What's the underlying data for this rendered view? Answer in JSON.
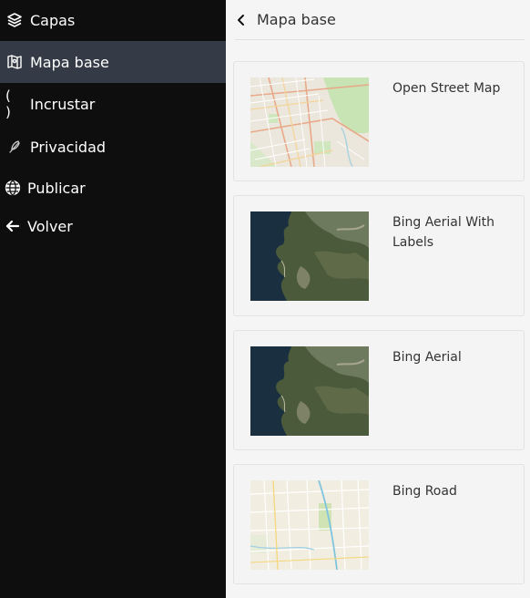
{
  "sidebar": {
    "items": [
      {
        "label": "Capas",
        "icon": "layers-icon",
        "active": false
      },
      {
        "label": "Mapa base",
        "icon": "map-icon",
        "active": true
      },
      {
        "label": "Incrustar",
        "icon": "parentheses-icon",
        "active": false
      },
      {
        "label": "Privacidad",
        "icon": "feather-icon",
        "active": false
      },
      {
        "label": "Publicar",
        "icon": "globe-icon",
        "active": false
      },
      {
        "label": "Volver",
        "icon": "arrow-left-icon",
        "active": false
      }
    ],
    "paren_glyph": "( )"
  },
  "panel": {
    "title": "Mapa base",
    "back_icon": "chevron-left-icon"
  },
  "basemaps": [
    {
      "label": "Open Street Map",
      "thumb": "street-map"
    },
    {
      "label": "Bing Aerial With Labels",
      "thumb": "aerial"
    },
    {
      "label": "Bing Aerial",
      "thumb": "aerial"
    },
    {
      "label": "Bing Road",
      "thumb": "road-map"
    }
  ],
  "colors": {
    "sidebar_bg": "#0e0e0e",
    "sidebar_active": "#343a46",
    "panel_bg": "#f5f5f5"
  }
}
